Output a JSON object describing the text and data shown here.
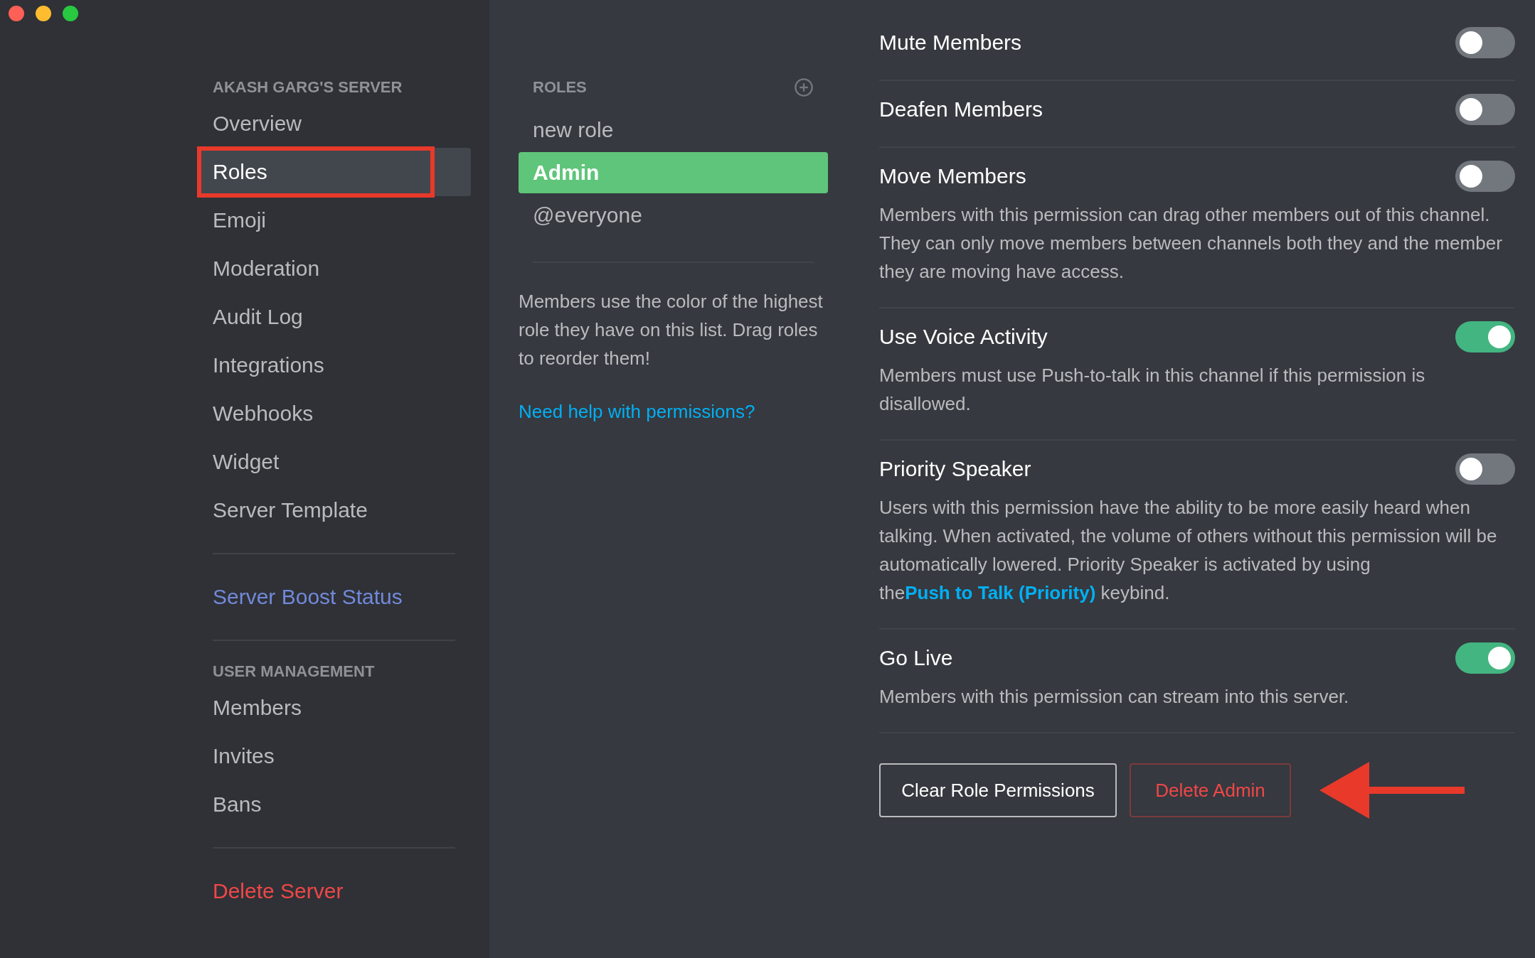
{
  "sidebar": {
    "sections": [
      {
        "header": "AKASH GARG'S SERVER",
        "items": [
          {
            "label": "Overview",
            "kind": "normal",
            "selected": false,
            "annotated": false
          },
          {
            "label": "Roles",
            "kind": "normal",
            "selected": true,
            "annotated": true
          },
          {
            "label": "Emoji",
            "kind": "normal",
            "selected": false,
            "annotated": false
          },
          {
            "label": "Moderation",
            "kind": "normal",
            "selected": false,
            "annotated": false
          },
          {
            "label": "Audit Log",
            "kind": "normal",
            "selected": false,
            "annotated": false
          },
          {
            "label": "Integrations",
            "kind": "normal",
            "selected": false,
            "annotated": false
          },
          {
            "label": "Webhooks",
            "kind": "normal",
            "selected": false,
            "annotated": false
          },
          {
            "label": "Widget",
            "kind": "normal",
            "selected": false,
            "annotated": false
          },
          {
            "label": "Server Template",
            "kind": "normal",
            "selected": false,
            "annotated": false
          }
        ]
      },
      {
        "items": [
          {
            "label": "Server Boost Status",
            "kind": "boost",
            "selected": false,
            "annotated": false
          }
        ]
      },
      {
        "header": "USER MANAGEMENT",
        "items": [
          {
            "label": "Members",
            "kind": "normal",
            "selected": false,
            "annotated": false
          },
          {
            "label": "Invites",
            "kind": "normal",
            "selected": false,
            "annotated": false
          },
          {
            "label": "Bans",
            "kind": "normal",
            "selected": false,
            "annotated": false
          }
        ]
      },
      {
        "items": [
          {
            "label": "Delete Server",
            "kind": "danger",
            "selected": false,
            "annotated": false
          }
        ]
      }
    ]
  },
  "roles": {
    "header": "ROLES",
    "items": [
      {
        "label": "new role",
        "selected": false
      },
      {
        "label": "Admin",
        "selected": true
      },
      {
        "label": "@everyone",
        "selected": false
      }
    ],
    "hint": "Members use the color of the highest role they have on this list. Drag roles to reorder them!",
    "help_link": "Need help with permissions?"
  },
  "permissions": [
    {
      "title": "Mute Members",
      "on": false
    },
    {
      "title": "Deafen Members",
      "on": false
    },
    {
      "title": "Move Members",
      "on": false,
      "description": "Members with this permission can drag other members out of this channel. They can only move members between channels both they and the member they are moving have access."
    },
    {
      "title": "Use Voice Activity",
      "on": true,
      "description": "Members must use Push-to-talk in this channel if this permission is disallowed."
    },
    {
      "title": "Priority Speaker",
      "on": false,
      "description": "Users with this permission have the ability to be more easily heard when talking. When activated, the volume of others without this permission will be automatically lowered. Priority Speaker is activated by using the",
      "link": "Push to Talk (Priority)",
      "description_end": "keybind."
    },
    {
      "title": "Go Live",
      "on": true,
      "description": "Members with this permission can stream into this server."
    }
  ],
  "buttons": {
    "clear": "Clear Role Permissions",
    "delete": "Delete Admin"
  }
}
